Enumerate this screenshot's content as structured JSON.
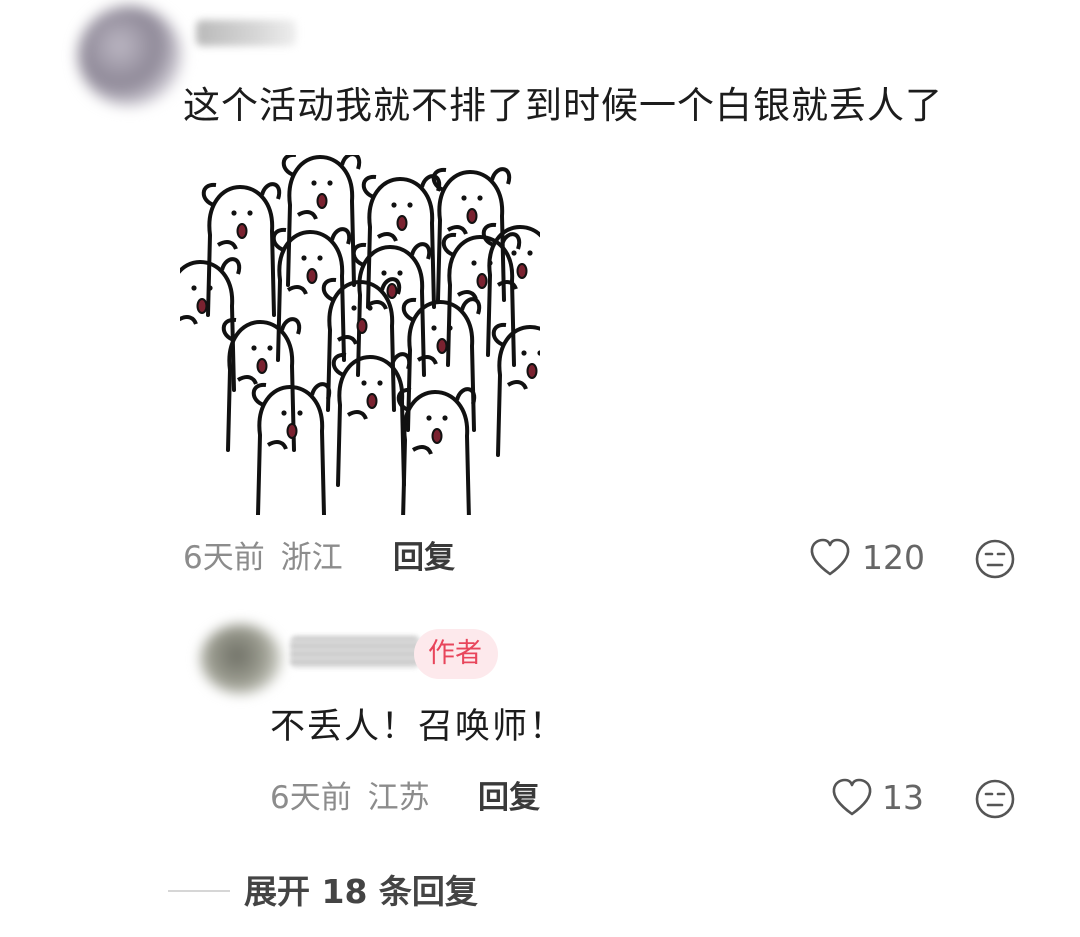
{
  "comment": {
    "text": "这个活动我就不排了到时候一个白银就丢人了",
    "time": "6天前",
    "location": "浙江",
    "reply_label": "回复",
    "likes": "120"
  },
  "reply": {
    "author_badge": "作者",
    "text": "不丢人！召唤师！",
    "time": "6天前",
    "location": "江苏",
    "reply_label": "回复",
    "likes": "13"
  },
  "expand": {
    "label": "展开 18 条回复"
  },
  "icons": {
    "like": "heart-outline-icon",
    "reaction": "meh-face-icon"
  }
}
